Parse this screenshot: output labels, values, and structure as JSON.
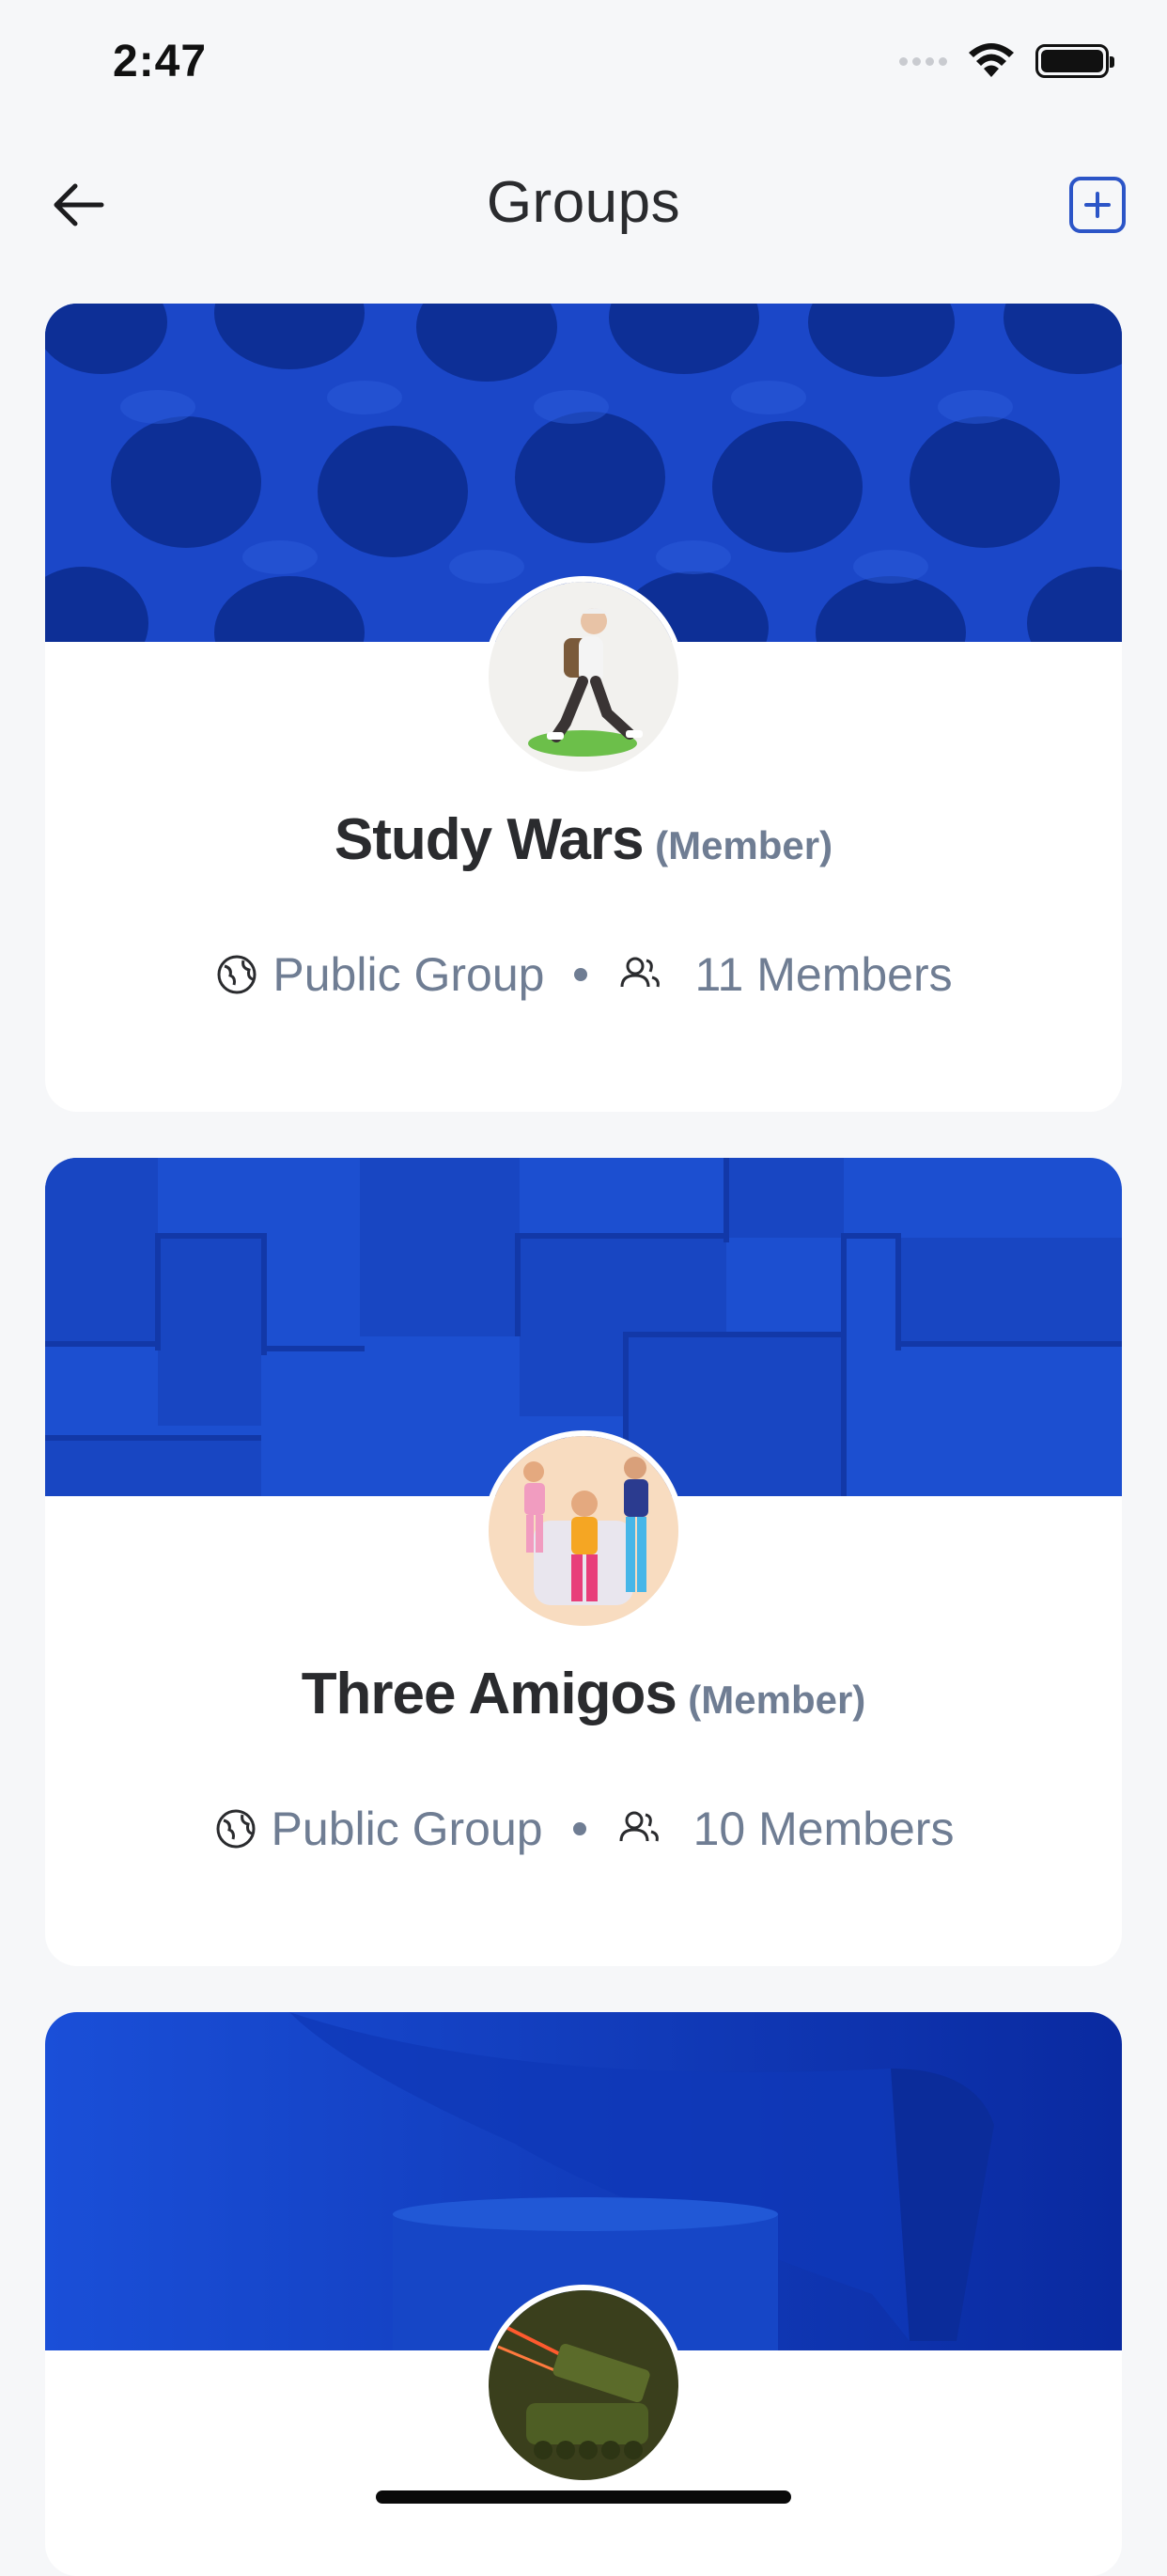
{
  "status": {
    "time": "2:47"
  },
  "header": {
    "title": "Groups"
  },
  "groups": [
    {
      "name": "Study Wars",
      "role": "(Member)",
      "privacy": "Public Group",
      "members": "11 Members"
    },
    {
      "name": "Three Amigos",
      "role": "(Member)",
      "privacy": "Public Group",
      "members": "10 Members"
    },
    {
      "name": "",
      "role": "",
      "privacy": "",
      "members": ""
    }
  ],
  "colors": {
    "accent": "#2c55c7",
    "banner_blue": "#1a45c4",
    "muted_text": "#6f7d93"
  }
}
